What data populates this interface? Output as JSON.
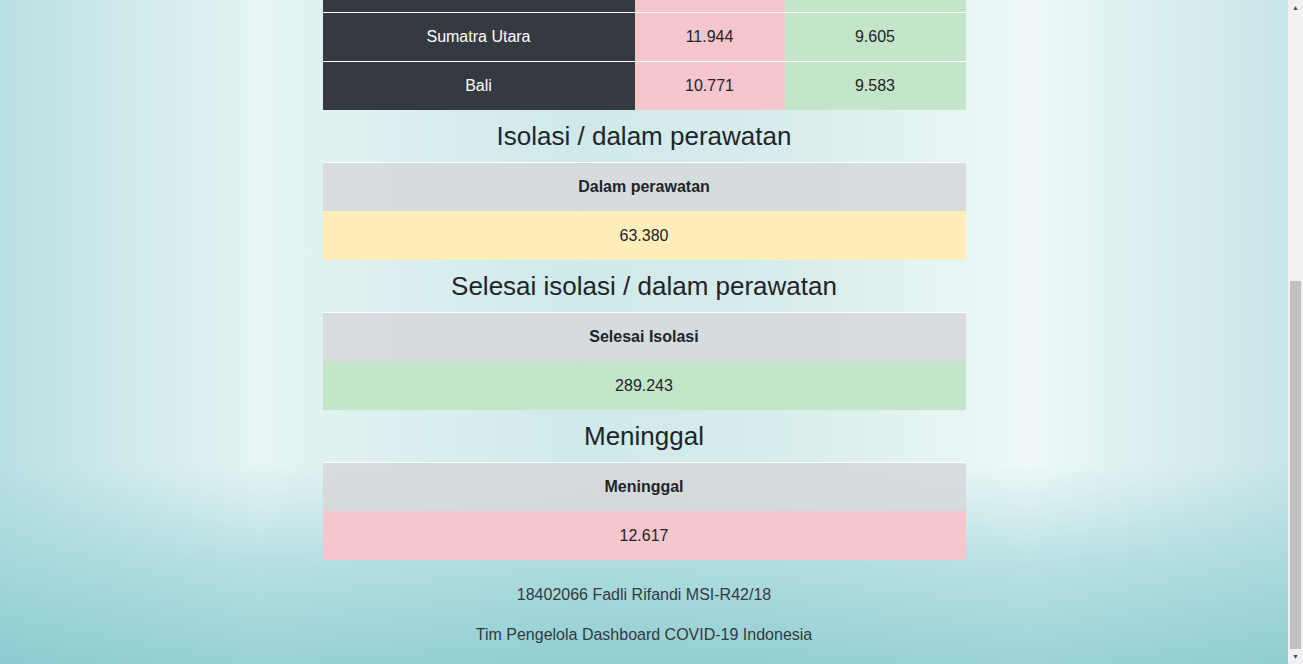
{
  "table": {
    "rows": [
      {
        "province": "Sumatra Utara",
        "positive": "11.944",
        "recovered": "9.605"
      },
      {
        "province": "Bali",
        "positive": "10.771",
        "recovered": "9.583"
      }
    ]
  },
  "sections": [
    {
      "heading": "Isolasi / dalam perawatan",
      "label": "Dalam perawatan",
      "value": "63.380",
      "color": "#ffeeba"
    },
    {
      "heading": "Selesai isolasi / dalam perawatan",
      "label": "Selesai Isolasi",
      "value": "289.243",
      "color": "#c3e6cb"
    },
    {
      "heading": "Meninggal",
      "label": "Meninggal",
      "value": "12.617",
      "color": "#f5c6cb"
    }
  ],
  "footer": [
    "18402066 Fadli Rifandi MSI-R42/18",
    "Tim Pengelola Dashboard COVID-19 Indonesia"
  ],
  "scrollbar": {
    "level": 0.58,
    "up": "▲",
    "down": "▼"
  }
}
